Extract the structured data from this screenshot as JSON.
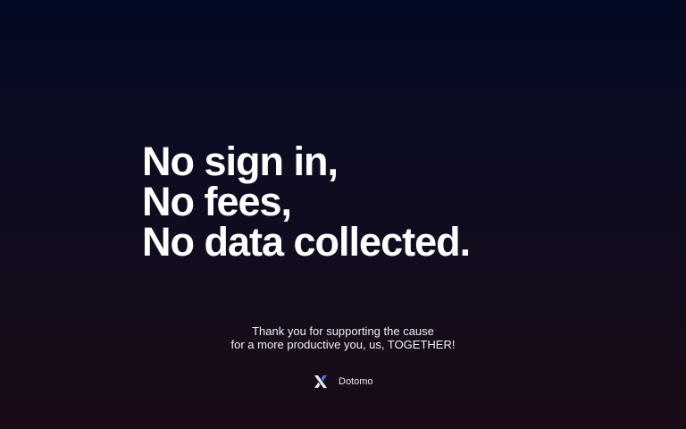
{
  "headline": {
    "lines": [
      "No sign in,",
      "No fees,",
      "No data collected."
    ]
  },
  "message": {
    "lines": [
      "Thank you for supporting the cause",
      "for a more productive you, us, TOGETHER!"
    ]
  },
  "brand": {
    "name": "Dotomo",
    "logo_icon": "dotomo-x-logo-icon",
    "colors": {
      "light": "#e6e8f2",
      "accent": "#4a78d8"
    }
  },
  "colors": {
    "background_top": "#030a23",
    "background_bottom": "#1a0b16",
    "text": "#ffffff"
  }
}
